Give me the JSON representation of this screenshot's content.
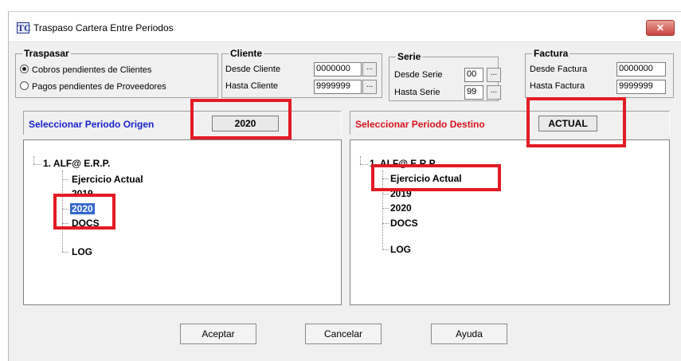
{
  "window": {
    "title": "Traspaso Cartera Entre Periodos",
    "icon_label": "TC",
    "close_glyph": "✕"
  },
  "traspasar": {
    "legend": "Traspasar",
    "options": [
      {
        "label": "Cobros pendientes de Clientes",
        "selected": true
      },
      {
        "label": "Pagos pendientes de Proveedores",
        "selected": false
      }
    ]
  },
  "cliente": {
    "legend": "Cliente",
    "desde_label": "Desde Cliente",
    "desde_value": "0000000",
    "hasta_label": "Hasta Cliente",
    "hasta_value": "9999999",
    "browse": "..."
  },
  "serie": {
    "legend": "Serie",
    "desde_label": "Desde Serie",
    "desde_value": "00",
    "hasta_label": "Hasta Serie",
    "hasta_value": "99",
    "browse": "..."
  },
  "factura": {
    "legend": "Factura",
    "desde_label": "Desde Factura",
    "desde_value": "0000000",
    "hasta_label": "Hasta Factura",
    "hasta_value": "9999999"
  },
  "origen": {
    "label": "Seleccionar Periodo Origen",
    "label_color": "#1a22cc",
    "selected_period": "2020",
    "tree": {
      "root": "1. ALF@ E.R.P.",
      "children": [
        "Ejercicio Actual",
        "2019",
        "2020",
        "DOCS",
        "LOG"
      ],
      "selected": "2020"
    }
  },
  "destino": {
    "label": "Seleccionar Periodo Destino",
    "label_color": "#d8141e",
    "selected_period": "ACTUAL",
    "tree": {
      "root": "1. ALF@ E.R.P.",
      "children": [
        "Ejercicio Actual",
        "2019",
        "2020",
        "DOCS",
        "LOG"
      ],
      "selected": "Ejercicio Actual"
    }
  },
  "buttons": {
    "aceptar": "Aceptar",
    "cancelar": "Cancelar",
    "ayuda": "Ayuda"
  },
  "highlight_color": "#e31b23"
}
